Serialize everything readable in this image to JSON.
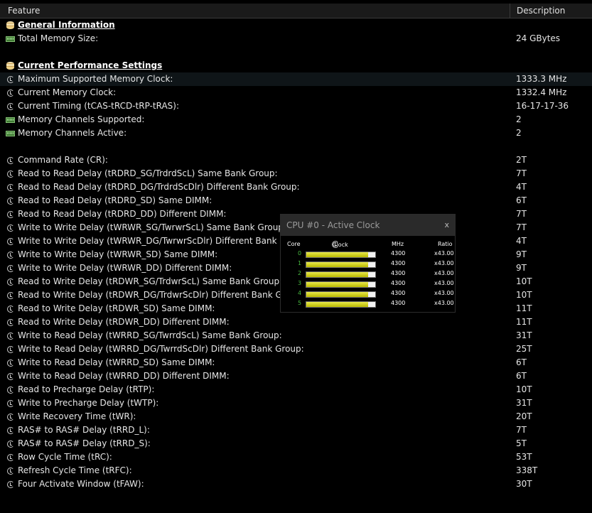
{
  "header": {
    "feature": "Feature",
    "description": "Description"
  },
  "rows": [
    {
      "type": "section",
      "icon": "database-icon",
      "label": "General Information",
      "value": ""
    },
    {
      "type": "item",
      "icon": "memory-icon",
      "label": "Total Memory Size:",
      "value": "24 GBytes"
    },
    {
      "type": "blank"
    },
    {
      "type": "section",
      "icon": "database-icon",
      "label": "Current Performance Settings",
      "value": ""
    },
    {
      "type": "item",
      "icon": "clock-icon",
      "label": "Maximum Supported Memory Clock:",
      "value": "1333.3 MHz",
      "highlight": true
    },
    {
      "type": "item",
      "icon": "clock-icon",
      "label": "Current Memory Clock:",
      "value": "1332.4 MHz"
    },
    {
      "type": "item",
      "icon": "clock-icon",
      "label": "Current Timing (tCAS-tRCD-tRP-tRAS):",
      "value": "16-17-17-36"
    },
    {
      "type": "item",
      "icon": "memory-icon",
      "label": "Memory Channels Supported:",
      "value": "2"
    },
    {
      "type": "item",
      "icon": "memory-icon",
      "label": "Memory Channels Active:",
      "value": "2"
    },
    {
      "type": "blank"
    },
    {
      "type": "item",
      "icon": "clock-icon",
      "label": "Command Rate (CR):",
      "value": "2T"
    },
    {
      "type": "item",
      "icon": "clock-icon",
      "label": "Read to Read Delay (tRDRD_SG/TrdrdScL) Same Bank Group:",
      "value": "7T"
    },
    {
      "type": "item",
      "icon": "clock-icon",
      "label": "Read to Read Delay (tRDRD_DG/TrdrdScDlr) Different Bank Group:",
      "value": "4T"
    },
    {
      "type": "item",
      "icon": "clock-icon",
      "label": "Read to Read Delay (tRDRD_SD) Same DIMM:",
      "value": "6T"
    },
    {
      "type": "item",
      "icon": "clock-icon",
      "label": "Read to Read Delay (tRDRD_DD) Different DIMM:",
      "value": "7T"
    },
    {
      "type": "item",
      "icon": "clock-icon",
      "label": "Write to Write Delay (tWRWR_SG/TwrwrScL) Same Bank Group:",
      "value": "7T"
    },
    {
      "type": "item",
      "icon": "clock-icon",
      "label": "Write to Write Delay (tWRWR_DG/TwrwrScDlr) Different Bank Grou",
      "value": "4T"
    },
    {
      "type": "item",
      "icon": "clock-icon",
      "label": "Write to Write Delay (tWRWR_SD) Same DIMM:",
      "value": "9T"
    },
    {
      "type": "item",
      "icon": "clock-icon",
      "label": "Write to Write Delay (tWRWR_DD) Different DIMM:",
      "value": "9T"
    },
    {
      "type": "item",
      "icon": "clock-icon",
      "label": "Read to Write Delay (tRDWR_SG/TrdwrScL) Same Bank Group:",
      "value": "10T"
    },
    {
      "type": "item",
      "icon": "clock-icon",
      "label": "Read to Write Delay (tRDWR_DG/TrdwrScDlr) Different Bank Group",
      "value": "10T"
    },
    {
      "type": "item",
      "icon": "clock-icon",
      "label": "Read to Write Delay (tRDWR_SD) Same DIMM:",
      "value": "11T"
    },
    {
      "type": "item",
      "icon": "clock-icon",
      "label": "Read to Write Delay (tRDWR_DD) Different DIMM:",
      "value": "11T"
    },
    {
      "type": "item",
      "icon": "clock-icon",
      "label": "Write to Read Delay (tWRRD_SG/TwrrdScL) Same Bank Group:",
      "value": "31T"
    },
    {
      "type": "item",
      "icon": "clock-icon",
      "label": "Write to Read Delay (tWRRD_DG/TwrrdScDlr) Different Bank Group:",
      "value": "25T"
    },
    {
      "type": "item",
      "icon": "clock-icon",
      "label": "Write to Read Delay (tWRRD_SD) Same DIMM:",
      "value": "6T"
    },
    {
      "type": "item",
      "icon": "clock-icon",
      "label": "Write to Read Delay (tWRRD_DD) Different DIMM:",
      "value": "6T"
    },
    {
      "type": "item",
      "icon": "clock-icon",
      "label": "Read to Precharge Delay (tRTP):",
      "value": "10T"
    },
    {
      "type": "item",
      "icon": "clock-icon",
      "label": "Write to Precharge Delay (tWTP):",
      "value": "31T"
    },
    {
      "type": "item",
      "icon": "clock-icon",
      "label": "Write Recovery Time (tWR):",
      "value": "20T"
    },
    {
      "type": "item",
      "icon": "clock-icon",
      "label": "RAS# to RAS# Delay (tRRD_L):",
      "value": "7T"
    },
    {
      "type": "item",
      "icon": "clock-icon",
      "label": "RAS# to RAS# Delay (tRRD_S):",
      "value": "5T"
    },
    {
      "type": "item",
      "icon": "clock-icon",
      "label": "Row Cycle Time (tRC):",
      "value": "53T"
    },
    {
      "type": "item",
      "icon": "clock-icon",
      "label": "Refresh Cycle Time (tRFC):",
      "value": "338T"
    },
    {
      "type": "item",
      "icon": "clock-icon",
      "label": "Four Activate Window (tFAW):",
      "value": "30T"
    }
  ],
  "popup": {
    "title": "CPU #0 - Active Clock",
    "close": "x",
    "columns": {
      "core": "Core",
      "clock": "Clock",
      "mhz": "MHz",
      "ratio": "Ratio"
    },
    "cores": [
      {
        "id": "0",
        "mhz": "4300",
        "ratio": "x43.00",
        "level": 0.9
      },
      {
        "id": "1",
        "mhz": "4300",
        "ratio": "x43.00",
        "level": 0.9
      },
      {
        "id": "2",
        "mhz": "4300",
        "ratio": "x43.00",
        "level": 0.9
      },
      {
        "id": "3",
        "mhz": "4300",
        "ratio": "x43.00",
        "level": 0.9
      },
      {
        "id": "4",
        "mhz": "4300",
        "ratio": "x43.00",
        "level": 0.9
      },
      {
        "id": "5",
        "mhz": "4300",
        "ratio": "x43.00",
        "level": 0.9
      }
    ]
  },
  "colors": {
    "background": "#000000",
    "core_id": "#45b83e",
    "bar_fill": "#d4d41a"
  }
}
